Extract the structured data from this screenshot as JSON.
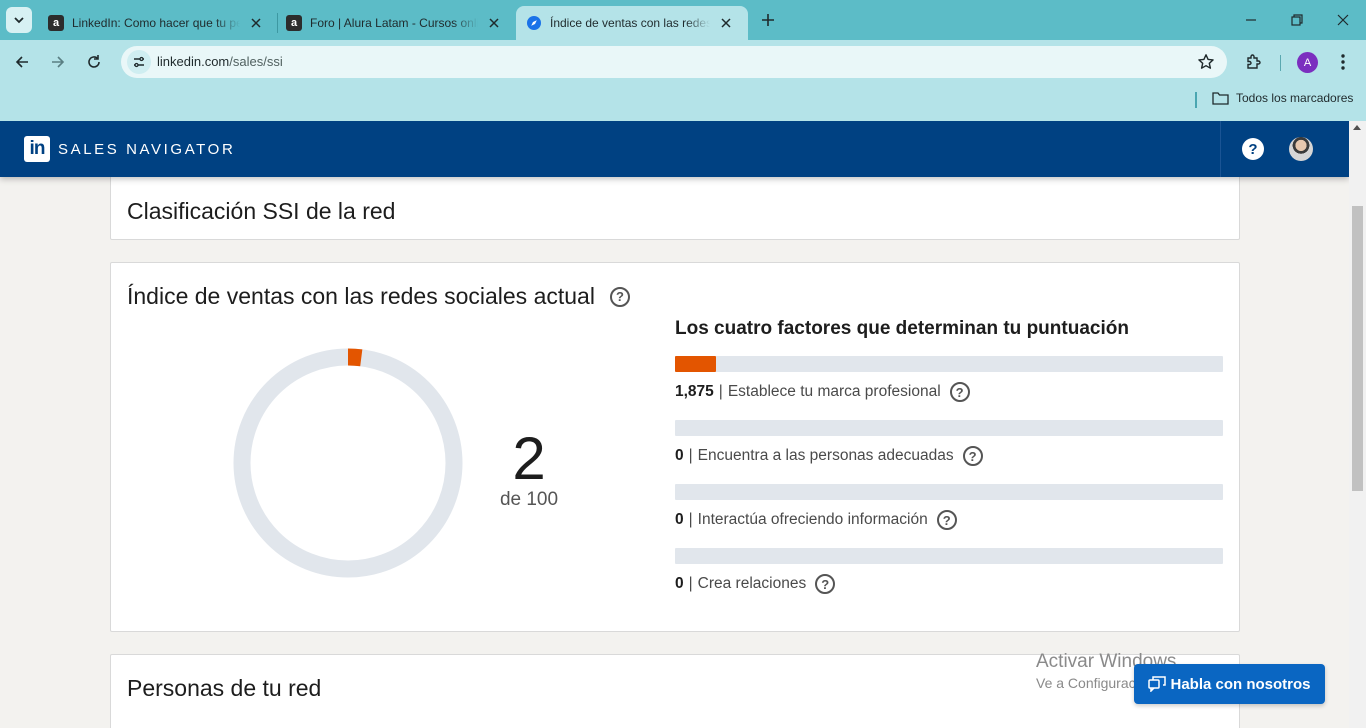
{
  "browser": {
    "tabs": [
      {
        "favicon": "a",
        "title": "LinkedIn: Como hacer que tu perfil",
        "active": false
      },
      {
        "favicon": "a",
        "title": "Foro | Alura Latam - Cursos online",
        "active": false
      },
      {
        "favicon": "compass-icon",
        "title": "Índice de ventas con las redes sociales",
        "active": true
      }
    ],
    "url_host": "linkedin.com",
    "url_path": "/sales/ssi",
    "profile_initial": "A",
    "bookmarks_all_label": "Todos los marcadores",
    "accent_color": "#5cbcc7"
  },
  "header": {
    "logo_text": "in",
    "brand": "SALES NAVIGATOR",
    "help_label": "?",
    "bg_color": "#004182"
  },
  "ranking_card": {
    "title": "Clasificación SSI de la red"
  },
  "ssi_card": {
    "title": "Índice de ventas con las redes sociales actual",
    "help": "?",
    "score": "2",
    "score_max": "de 100",
    "score_value": 2,
    "score_total": 100,
    "factors_title": "Los cuatro factores que determinan tu puntuación",
    "factors": [
      {
        "value": "1,875",
        "label": "Establece tu marca profesional",
        "fraction": 0.075
      },
      {
        "value": "0",
        "label": "Encuentra a las personas adecuadas",
        "fraction": 0
      },
      {
        "value": "0",
        "label": "Interactúa ofreciendo información",
        "fraction": 0
      },
      {
        "value": "0",
        "label": "Crea relaciones",
        "fraction": 0
      }
    ],
    "accent_color": "#e35500"
  },
  "people_card": {
    "title": "Personas de tu red"
  },
  "windows_watermark": {
    "line1": "Activar Windows",
    "line2": "Ve a Configuración para activar Windows."
  },
  "chat": {
    "label": "Habla con nosotros"
  }
}
